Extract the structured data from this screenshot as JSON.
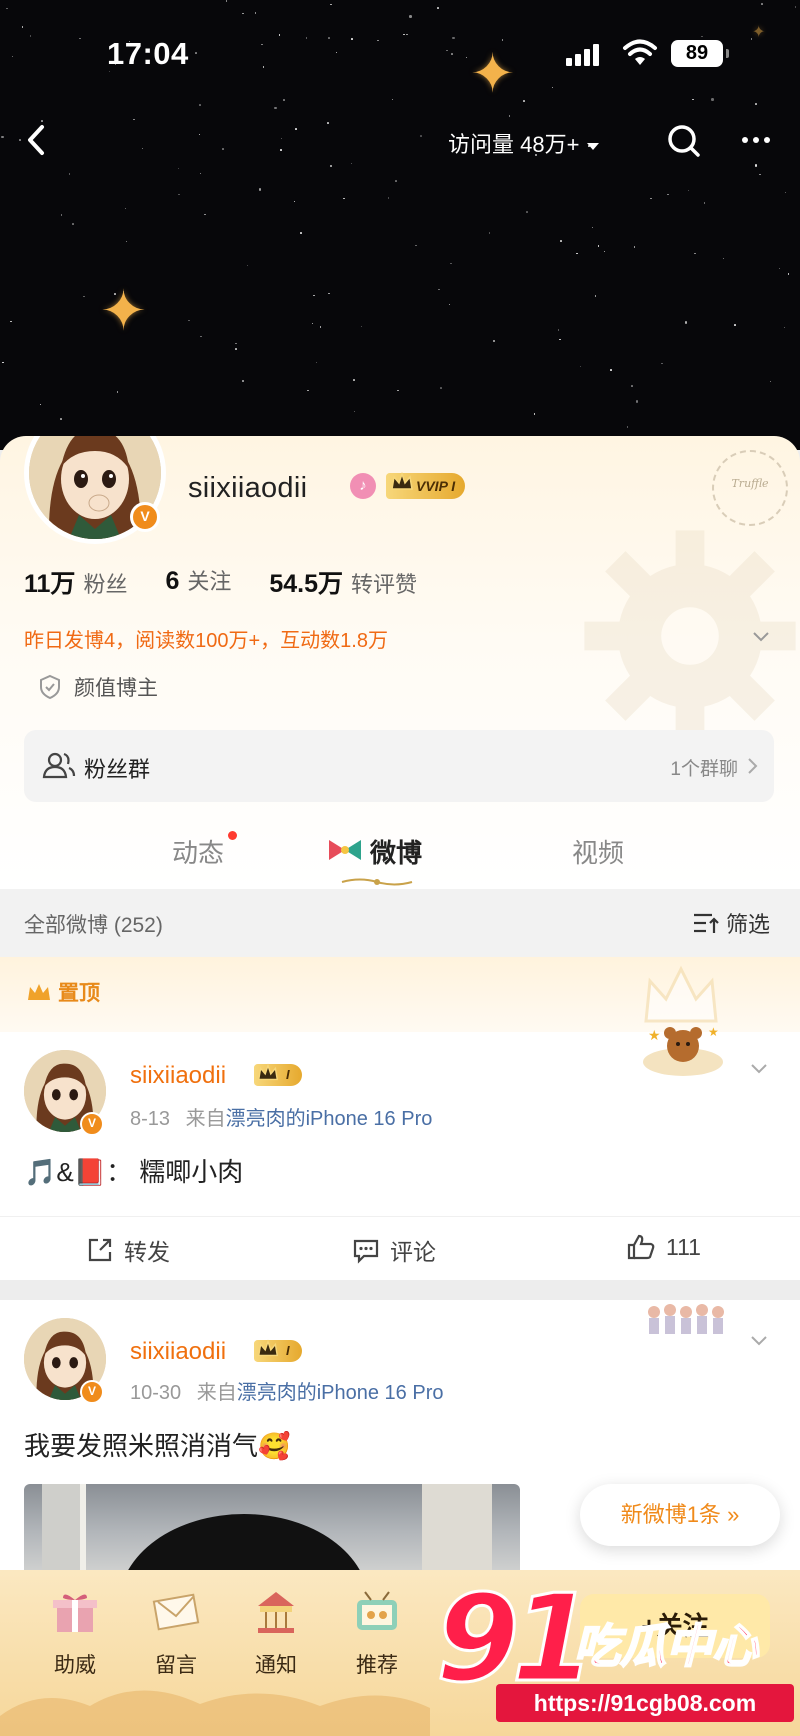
{
  "status_bar": {
    "time": "17:04",
    "battery": "89"
  },
  "nav": {
    "visits_label": "访问量 48万+"
  },
  "profile": {
    "username": "siixiiaodii",
    "vip_label": "VVIP I",
    "stats": [
      {
        "value": "11万",
        "label": "粉丝"
      },
      {
        "value": "6",
        "label": "关注"
      },
      {
        "value": "54.5万",
        "label": "转评赞"
      }
    ],
    "summary": "昨日发博4，阅读数100万+，互动数1.8万",
    "tag": "颜值博主",
    "fans_group": {
      "label": "粉丝群",
      "count": "1个群聊"
    },
    "tabs": [
      "动态",
      "微博",
      "视频"
    ]
  },
  "feed": {
    "all_posts_label": "全部微博 (252)",
    "filter_label": "筛选",
    "pinned_label": "置顶",
    "posts": [
      {
        "name": "siixiiaodii",
        "level": "I",
        "date": "8-13",
        "source_prefix": "来自",
        "source": "漂亮肉的iPhone 16 Pro",
        "text": "🎵&📕： 糯唧小肉",
        "repost_label": "转发",
        "comment_label": "评论",
        "likes": "111"
      },
      {
        "name": "siixiiaodii",
        "level": "I",
        "date": "10-30",
        "source_prefix": "来自",
        "source": "漂亮肉的iPhone 16 Pro",
        "text": "我要发照米照消消气🥰"
      }
    ],
    "new_posts_label": "新微博1条"
  },
  "bottom_bar": {
    "items": [
      "助威",
      "留言",
      "通知",
      "推荐"
    ],
    "follow_label": "+关注"
  },
  "watermark": {
    "logo": "91",
    "name": "吃瓜中心",
    "url": "https://91cgb08.com"
  },
  "colors": {
    "accent_orange": "#f0700e",
    "watermark_red": "#ff1f4a",
    "link_blue": "#4a6fa5"
  }
}
